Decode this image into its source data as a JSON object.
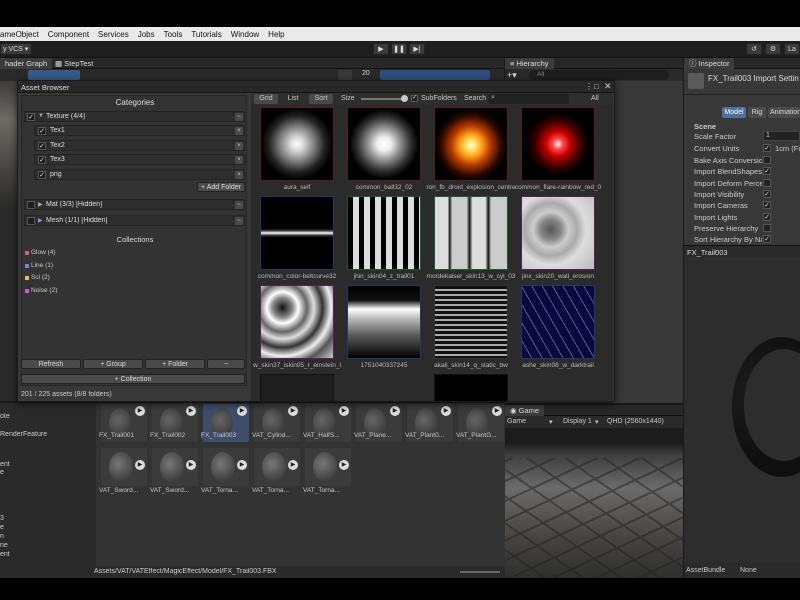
{
  "menu": [
    "ameObject",
    "Component",
    "Services",
    "Jobs",
    "Tools",
    "Tutorials",
    "Window",
    "Help"
  ],
  "toolbar": {
    "vcs_label": "y VCS ▾",
    "play_icon": "play-icon",
    "pause_icon": "pause-icon",
    "step_icon": "step-icon"
  },
  "tabs": {
    "shader_graph": "hader Graph",
    "steptest": "StepTest",
    "hierarchy": "Hierarchy",
    "inspector": "Inspector",
    "scene_num": "20",
    "hier_search": "All"
  },
  "asset_browser": {
    "title": "Asset Browser",
    "categories_header": "Categories",
    "categories": [
      {
        "label": "Texture  (4/4)",
        "children": [
          "Tex1",
          "Tex2",
          "Tex3",
          "png"
        ]
      },
      {
        "label": "Mat  (3/3) [Hidden]"
      },
      {
        "label": "Mesh  (1/1) [Hidden]"
      }
    ],
    "add_folder": "+ Add Folder",
    "collections_header": "Collections",
    "collections": [
      "Glow  (4)",
      "Line  (1)",
      "Sci  (2)",
      "Noise  (2)"
    ],
    "collection_colors": [
      "#e05a6a",
      "#6a8ae0",
      "#e0c05a",
      "#c05ae0"
    ],
    "buttons": {
      "refresh": "Refresh",
      "group": "+ Group",
      "folder": "+ Folder",
      "minus": "−",
      "collection": "+ Collection"
    },
    "status": "201 / 225 assets (8/8 folders)",
    "view_modes": [
      "Grid",
      "List",
      "Sort"
    ],
    "size_label": "Size",
    "subfolders_label": "SubFolders",
    "search_label": "Search",
    "filter_all": "All",
    "thumbnails": [
      "aura_self",
      "common_ball32_02",
      "ron_fb_droid_explosion_centre",
      "common_flare-rainbow_red_0",
      "common_color-beltcurve32",
      "jhin_skin04_z_trail01",
      "mordekaiser_skin13_w_cyl_03",
      "jinx_skin20_wall_erosion",
      "w_skin37_iskin05_r_einstein_l",
      "1751040337245",
      "akali_skin14_q_static_bw",
      "ashe_skin08_w_darktrail"
    ]
  },
  "project": {
    "left_items": [
      "ote",
      "RenderFeature",
      "ent",
      "e",
      "3",
      "e",
      "n",
      "ne",
      "ent"
    ],
    "row1": [
      "FX_Trail001",
      "FX_Trail002",
      "FX_Trail003",
      "VAT_Cylind...",
      "VAT_HalfS...",
      "VAT_Plane...",
      "VAT_Plant0...",
      "VAT_PlantG..."
    ],
    "row2": [
      "VAT_Sword...",
      "VAT_Sword...",
      "VAT_Torna...",
      "VAT_Torna...",
      "VAT_Torna..."
    ],
    "path": "Assets/VAT/VATEffect/MagicEffect/Model/FX_Trail003.FBX"
  },
  "game": {
    "tab": "Game",
    "mode": "Game",
    "display": "Display 1",
    "resolution": "QHD (2560x1440)"
  },
  "inspector": {
    "title": "FX_Trail003 Import Settin",
    "tabs": [
      "Model",
      "Rig",
      "Animation"
    ],
    "section": "Scene",
    "scale_factor_label": "Scale Factor",
    "scale_factor_value": "1",
    "convert_units_label": "Convert Units",
    "convert_units_value": "1cm (Fil",
    "rows": [
      "Bake Axis Conversion",
      "Import BlendShapes",
      "Import Deform Percent",
      "Import Visibility",
      "Import Cameras",
      "Import Lights",
      "Preserve Hierarchy",
      "Sort Hierarchy By Na"
    ],
    "row_checked": [
      false,
      true,
      false,
      true,
      true,
      true,
      false,
      true
    ],
    "preview_label": "FX_Trail003",
    "asset_bundle_label": "AssetBundle",
    "asset_bundle_value": "None"
  }
}
